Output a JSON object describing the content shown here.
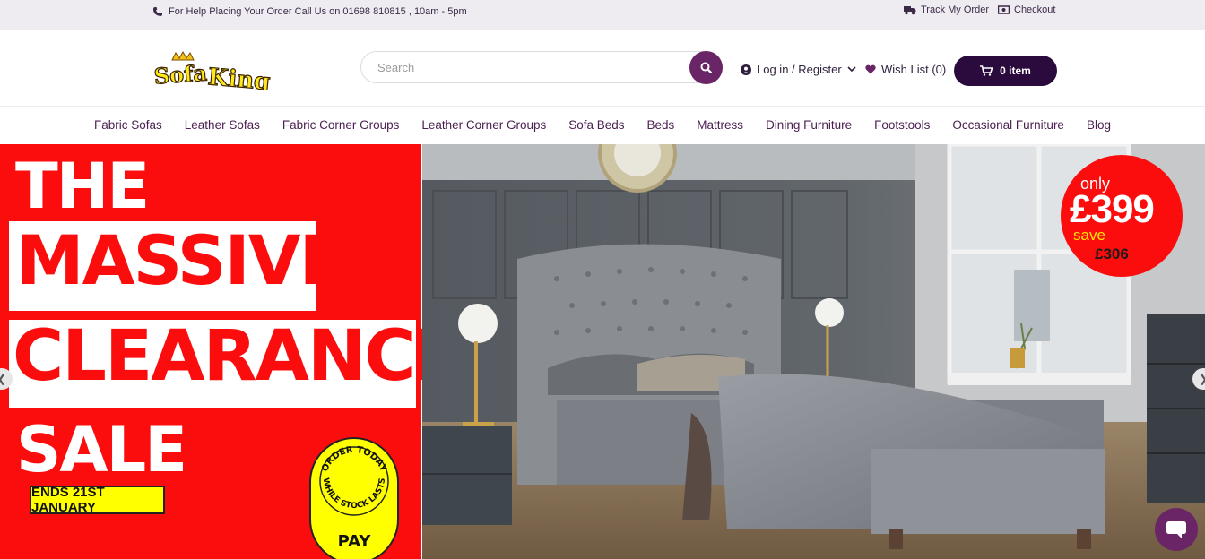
{
  "topbar": {
    "help_text": "For Help Placing Your Order Call Us on 01698 810815 , 10am - 5pm",
    "track_order": "Track My Order",
    "checkout": "Checkout"
  },
  "header": {
    "logo_text": "Sofa King",
    "search_placeholder": "Search",
    "account_label": "Log in / Register",
    "wishlist_label": "Wish List (0)",
    "cart_label": "0 item"
  },
  "nav": {
    "items": [
      "Fabric Sofas",
      "Leather Sofas",
      "Fabric Corner Groups",
      "Leather Corner Groups",
      "Sofa Beds",
      "Beds",
      "Mattress",
      "Dining Furniture",
      "Footstools",
      "Occasional Furniture",
      "Blog"
    ]
  },
  "hero": {
    "promo": {
      "line1": "THE",
      "line2": "MASSIVE",
      "line3": "CLEARANCE",
      "line4": "SALE",
      "ends": "ENDS 21ST JANUARY",
      "badge_top": "ORDER TODAY",
      "badge_bottom": "WHILE STOCK LASTS",
      "badge_pay": "PAY"
    },
    "price": {
      "only": "only",
      "amount": "£399",
      "save": "save",
      "saving": "£306"
    }
  },
  "colors": {
    "brand_purple": "#6a2566",
    "cart_dark": "#2b0a3d",
    "promo_red": "#fb0d0d",
    "nav_text": "#4a1e4f"
  }
}
